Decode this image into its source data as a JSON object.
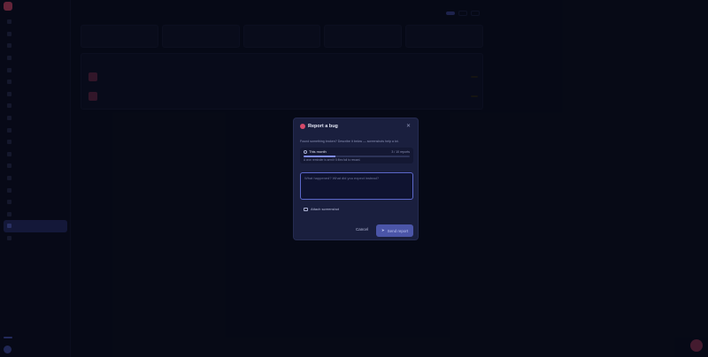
{
  "modal": {
    "title": "Report a bug",
    "close_glyph": "✕",
    "description": "Found something broken? Describe it below — screenshots help a lot.",
    "quota": {
      "label": "This month",
      "count": "3 / 10 reports",
      "used": 3,
      "limit": 10,
      "note": "A cron reminder is sent if 5 files fail to reward."
    },
    "textarea_placeholder": "What happened? What did you expect instead?",
    "attach_label": "Attach screenshot",
    "cancel_label": "Cancel",
    "send_label": "Send report"
  },
  "colors": {
    "accent": "#5b67c9",
    "bug_red": "#d64a6a",
    "modal_bg": "#1a1f3e",
    "page_bg": "#0b0e1e"
  },
  "icons": [
    "bug-icon",
    "close-icon",
    "clock-icon",
    "image-icon",
    "send-icon"
  ]
}
